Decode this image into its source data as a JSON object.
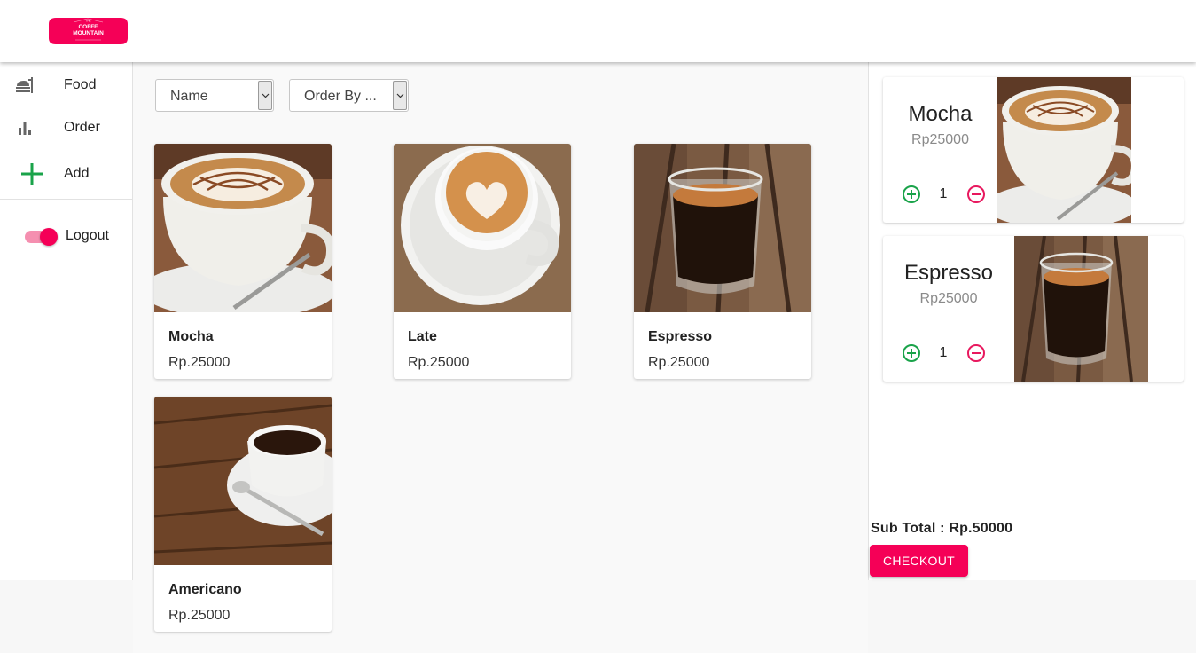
{
  "header": {
    "logo": {
      "line_small": "THE",
      "line1": "COFFE",
      "line2": "MOUNTAIN",
      "brand_color": "#f50057"
    }
  },
  "sidebar": {
    "items": [
      {
        "label": "Food",
        "icon": "food-tray-icon"
      },
      {
        "label": "Order",
        "icon": "bar-chart-icon"
      },
      {
        "label": "Add",
        "icon": "plus-icon"
      }
    ],
    "logout": {
      "label": "Logout",
      "toggle_on": true
    }
  },
  "filters": {
    "sort_name": "Name",
    "order_by": "Order By ..."
  },
  "products": [
    {
      "name": "Mocha",
      "price": "Rp.25000",
      "image": "mocha-latte-art-photo"
    },
    {
      "name": "Late",
      "price": "Rp.25000",
      "image": "heart-latte-photo"
    },
    {
      "name": "Espresso",
      "price": "Rp.25000",
      "image": "espresso-shot-glass-photo"
    },
    {
      "name": "Americano",
      "price": "Rp.25000",
      "image": "americano-cup-photo"
    }
  ],
  "cart": {
    "items": [
      {
        "name": "Mocha",
        "price": "Rp25000",
        "qty": "1"
      },
      {
        "name": "Espresso",
        "price": "Rp25000",
        "qty": "1"
      }
    ],
    "subtotal": "Sub Total : Rp.50000",
    "checkout_label": "CHECKOUT"
  },
  "colors": {
    "accent": "#f50057",
    "add_green": "#1aa34a",
    "remove_pink": "#e8185e"
  }
}
